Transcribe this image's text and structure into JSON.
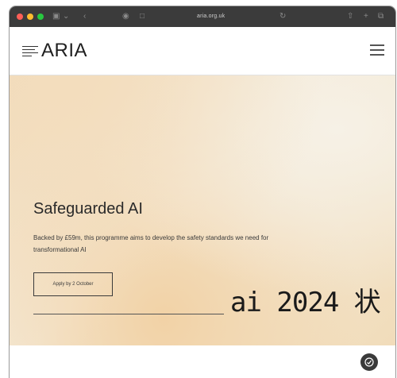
{
  "browser": {
    "address": "aria.org.uk",
    "icons": [
      "sidebar-icon",
      "back-icon",
      "shield-icon",
      "reader-icon",
      "reload-icon",
      "share-icon",
      "new-tab-icon",
      "tabs-icon"
    ]
  },
  "site": {
    "logo_text": "ARIA",
    "menu_icon": "hamburger-menu-icon"
  },
  "hero": {
    "title": "Safeguarded AI",
    "description": "Backed by £59m, this programme aims to develop the safety standards we need for transformational AI",
    "cta_label": "Apply by 2 October"
  },
  "overlay": {
    "watermark_text": "ai 2024 状"
  },
  "colors": {
    "toolbar": "#3b3b3b",
    "hero_peach": "#f1dab9",
    "hero_cream": "#f4ead8",
    "text_dark": "#2a2a2a"
  }
}
